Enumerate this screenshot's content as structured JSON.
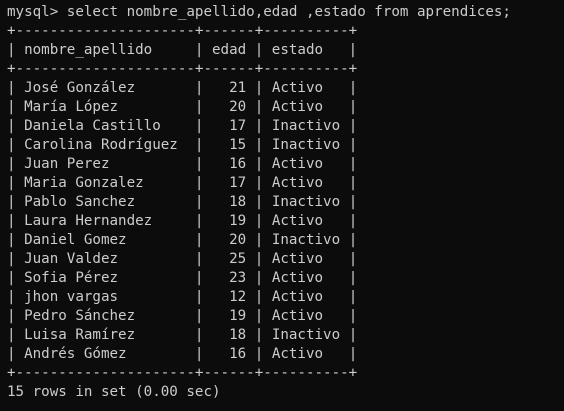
{
  "terminal": {
    "prompt": "mysql> ",
    "command": "select nombre_apellido,edad ,estado from aprendices;",
    "border": "+---------------------+------+----------+",
    "header": "| nombre_apellido     | edad | estado   |",
    "rows": [
      {
        "nombre_apellido": "José González",
        "edad": "21",
        "estado": "Activo"
      },
      {
        "nombre_apellido": "María López",
        "edad": "20",
        "estado": "Activo"
      },
      {
        "nombre_apellido": "Daniela Castillo",
        "edad": "17",
        "estado": "Inactivo"
      },
      {
        "nombre_apellido": "Carolina Rodríguez",
        "edad": "15",
        "estado": "Inactivo"
      },
      {
        "nombre_apellido": "Juan Perez",
        "edad": "16",
        "estado": "Activo"
      },
      {
        "nombre_apellido": "Maria Gonzalez",
        "edad": "17",
        "estado": "Activo"
      },
      {
        "nombre_apellido": "Pablo Sanchez",
        "edad": "18",
        "estado": "Inactivo"
      },
      {
        "nombre_apellido": "Laura Hernandez",
        "edad": "19",
        "estado": "Activo"
      },
      {
        "nombre_apellido": "Daniel Gomez",
        "edad": "20",
        "estado": "Inactivo"
      },
      {
        "nombre_apellido": "Juan Valdez",
        "edad": "25",
        "estado": "Activo"
      },
      {
        "nombre_apellido": "Sofia Pérez",
        "edad": "23",
        "estado": "Activo"
      },
      {
        "nombre_apellido": "jhon vargas",
        "edad": "12",
        "estado": "Activo"
      },
      {
        "nombre_apellido": "Pedro Sánchez",
        "edad": "19",
        "estado": "Activo"
      },
      {
        "nombre_apellido": "Luisa Ramírez",
        "edad": "18",
        "estado": "Inactivo"
      },
      {
        "nombre_apellido": "Andrés Gómez",
        "edad": "16",
        "estado": "Activo"
      }
    ],
    "footer": "15 rows in set (0.00 sec)",
    "colors": {
      "background": "#0c0c0c",
      "text": "#cccccc"
    }
  }
}
